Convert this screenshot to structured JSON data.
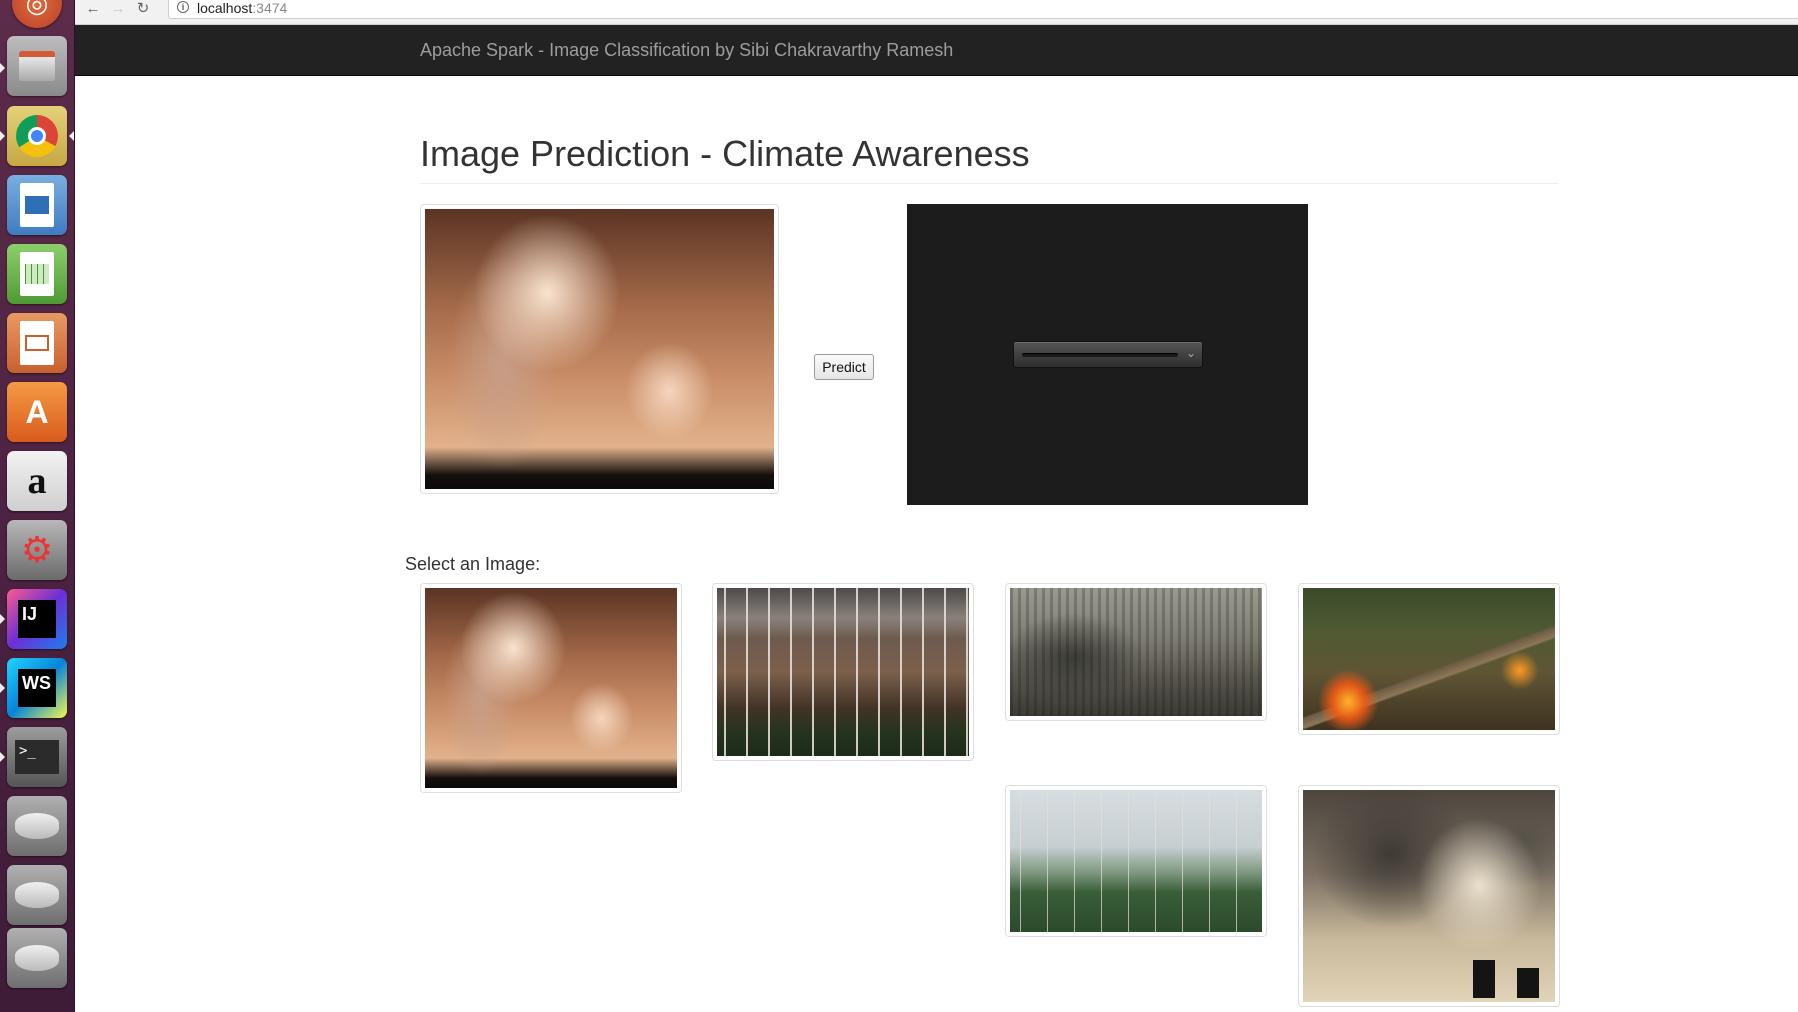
{
  "browser": {
    "url_host": "localhost",
    "url_port": ":3474",
    "info_icon": "i"
  },
  "navbar": {
    "brand": "Apache Spark - Image Classification by Sibi Chakravarthy Ramesh"
  },
  "main": {
    "title": "Image Prediction - Climate Awareness",
    "predict_label": "Predict",
    "select_label": "Select an Image:"
  },
  "launcher": {
    "items": [
      "ubuntu-dash",
      "files",
      "chrome",
      "libreoffice-writer",
      "libreoffice-calc",
      "libreoffice-impress",
      "software-center",
      "amazon",
      "system-settings",
      "intellij-idea",
      "webstorm",
      "terminal",
      "drive",
      "drive",
      "drive"
    ],
    "intellij_label": "IJ",
    "webstorm_label": "WS",
    "terminal_label": ">_",
    "amazon_label": "a",
    "store_label": "A"
  },
  "gallery": {
    "images": [
      "power-plant-smoke",
      "dead-forest-mountains",
      "ruined-city",
      "forest-fire",
      "dead-trees-forest",
      "factory-smokestacks"
    ]
  },
  "colors": {
    "navbar_bg": "#222222",
    "launcher_bg": "#4a2140",
    "result_panel_bg": "#1c1c1c"
  }
}
